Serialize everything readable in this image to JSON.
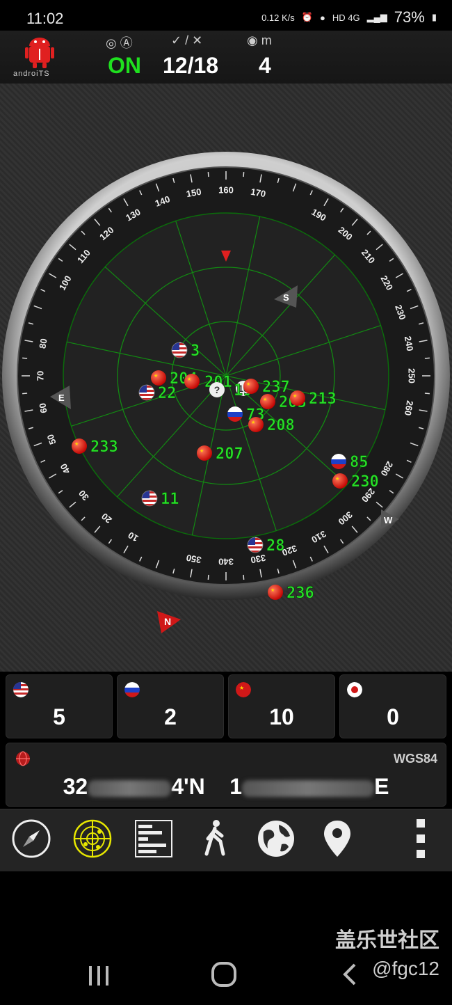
{
  "status_bar": {
    "time": "11:02",
    "net_speed": "0.12 K/s",
    "network": "HD 4G",
    "battery": "73%"
  },
  "header": {
    "brand": "androiTS",
    "status_value": "ON",
    "sats_value": "12/18",
    "accuracy_value": "4",
    "accuracy_unit": "m",
    "colors": {
      "on": "#1fe01f",
      "value": "#ffffff"
    }
  },
  "radar": {
    "compass_labels": [
      "10",
      "20",
      "30",
      "40",
      "50",
      "60",
      "70",
      "80",
      "100",
      "110",
      "120",
      "130",
      "140",
      "150",
      "160",
      "170",
      "190",
      "200",
      "210",
      "220",
      "230",
      "240",
      "250",
      "260",
      "280",
      "290",
      "300",
      "310",
      "320",
      "330",
      "340",
      "350"
    ],
    "cardinals": {
      "north": "N",
      "east": "E",
      "south": "S",
      "west": "W"
    },
    "satellites": [
      {
        "id": "3",
        "constellation": "gps"
      },
      {
        "id": "204",
        "constellation": "beidou"
      },
      {
        "id": "201",
        "constellation": "beidou"
      },
      {
        "id": "22",
        "constellation": "gps"
      },
      {
        "id": "?",
        "constellation": "unknown"
      },
      {
        "id": "19",
        "constellation": "unknown"
      },
      {
        "id": "237",
        "constellation": "beidou"
      },
      {
        "id": "203",
        "constellation": "beidou"
      },
      {
        "id": "213",
        "constellation": "beidou"
      },
      {
        "id": "73",
        "constellation": "glonass"
      },
      {
        "id": "208",
        "constellation": "beidou"
      },
      {
        "id": "233",
        "constellation": "beidou"
      },
      {
        "id": "207",
        "constellation": "beidou"
      },
      {
        "id": "85",
        "constellation": "glonass"
      },
      {
        "id": "230",
        "constellation": "beidou"
      },
      {
        "id": "11",
        "constellation": "gps"
      },
      {
        "id": "28",
        "constellation": "gps"
      },
      {
        "id": "236",
        "constellation": "beidou"
      }
    ]
  },
  "constellation_counts": [
    {
      "name": "gps",
      "count": "5"
    },
    {
      "name": "glonass",
      "count": "2"
    },
    {
      "name": "beidou",
      "count": "10"
    },
    {
      "name": "qzss",
      "count": "0"
    }
  ],
  "location": {
    "datum": "WGS84",
    "lat_prefix": "32",
    "lat_suffix": "4'N",
    "lon_prefix": "1",
    "lon_suffix": "E"
  },
  "toolbar": {
    "items": [
      "compass-icon",
      "radar-icon",
      "signal-bars-icon",
      "walking-icon",
      "globe-icon",
      "map-pin-icon",
      "more-icon"
    ]
  },
  "watermark": {
    "line1": "盖乐世社区",
    "line2": "@fgc12"
  }
}
